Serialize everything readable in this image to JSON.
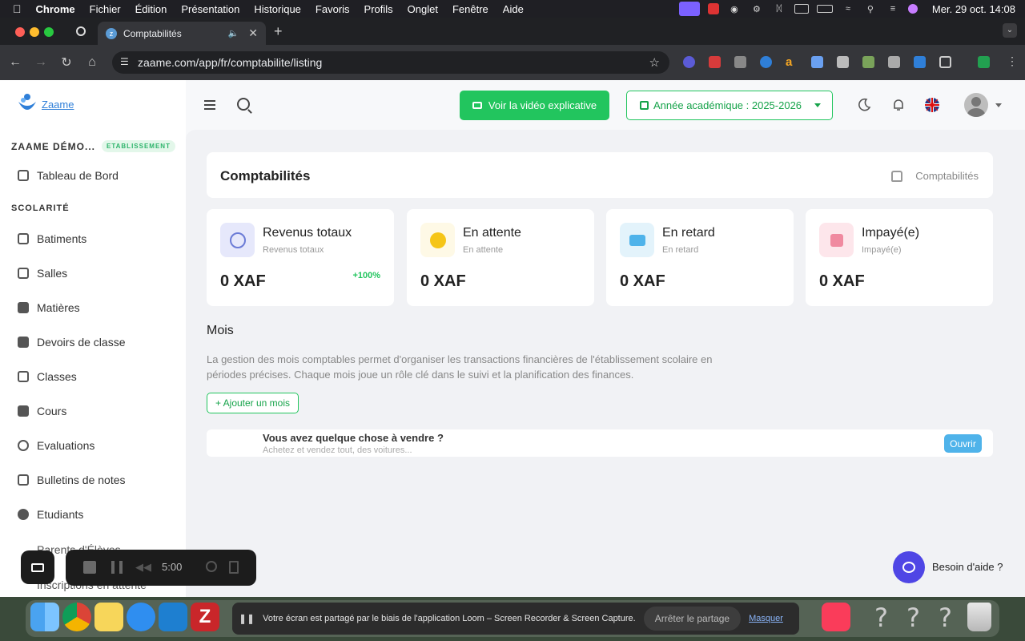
{
  "menubar": {
    "app": "Chrome",
    "items": [
      "Fichier",
      "Édition",
      "Présentation",
      "Historique",
      "Favoris",
      "Profils",
      "Onglet",
      "Fenêtre",
      "Aide"
    ],
    "clock": "Mer. 29 oct.  14:08"
  },
  "browser": {
    "tab_title": "Comptabilités",
    "url": "zaame.com/app/fr/comptabilite/listing"
  },
  "app": {
    "logo_text": "Zaame",
    "video_button": "Voir la vidéo explicative",
    "year_select": "Année académique : 2025-2026",
    "help_label": "Besoin d'aide ?"
  },
  "sidebar": {
    "org_name": "ZAAME DÉMO...",
    "org_badge": "ETABLISSEMENT",
    "dashboard": "Tableau de Bord",
    "section": "SCOLARITÉ",
    "items": [
      "Batiments",
      "Salles",
      "Matières",
      "Devoirs de classe",
      "Classes",
      "Cours",
      "Evaluations",
      "Bulletins de notes",
      "Etudiants",
      "Parents d'Élèves",
      "Inscriptions en attente"
    ]
  },
  "page": {
    "title": "Comptabilités",
    "breadcrumb": "Comptabilités"
  },
  "stats": [
    {
      "label": "Revenus totaux",
      "sub": "Revenus totaux",
      "value": "0 XAF",
      "pct": "+100%",
      "color": "#6b7bd6",
      "bg": "#e6e8fb"
    },
    {
      "label": "En attente",
      "sub": "En attente",
      "value": "0 XAF",
      "pct": "",
      "color": "#f5c518",
      "bg": "#fef9e6"
    },
    {
      "label": "En retard",
      "sub": "En retard",
      "value": "0 XAF",
      "pct": "",
      "color": "#4fb3ea",
      "bg": "#e3f3fb"
    },
    {
      "label": "Impayé(e)",
      "sub": "Impayé(e)",
      "value": "0 XAF",
      "pct": "",
      "color": "#f08aa0",
      "bg": "#fde6eb"
    }
  ],
  "mois": {
    "title": "Mois",
    "description": "La gestion des mois comptables permet d'organiser les transactions financières de l'établissement scolaire en périodes précises. Chaque mois joue un rôle clé dans le suivi et la planification des finances.",
    "add_button": "+ Ajouter un mois"
  },
  "ad": {
    "question": "Vous avez quelque chose à vendre ?",
    "subtitle": "Achetez et vendez tout, des voitures...",
    "button": "Ouvrir"
  },
  "recorder": {
    "time": "5:00"
  },
  "share_bar": {
    "message": "Votre écran est partagé par le biais de l'application Loom – Screen Recorder & Screen Capture.",
    "stop_button": "Arrêter le partage",
    "hide_link": "Masquer"
  }
}
